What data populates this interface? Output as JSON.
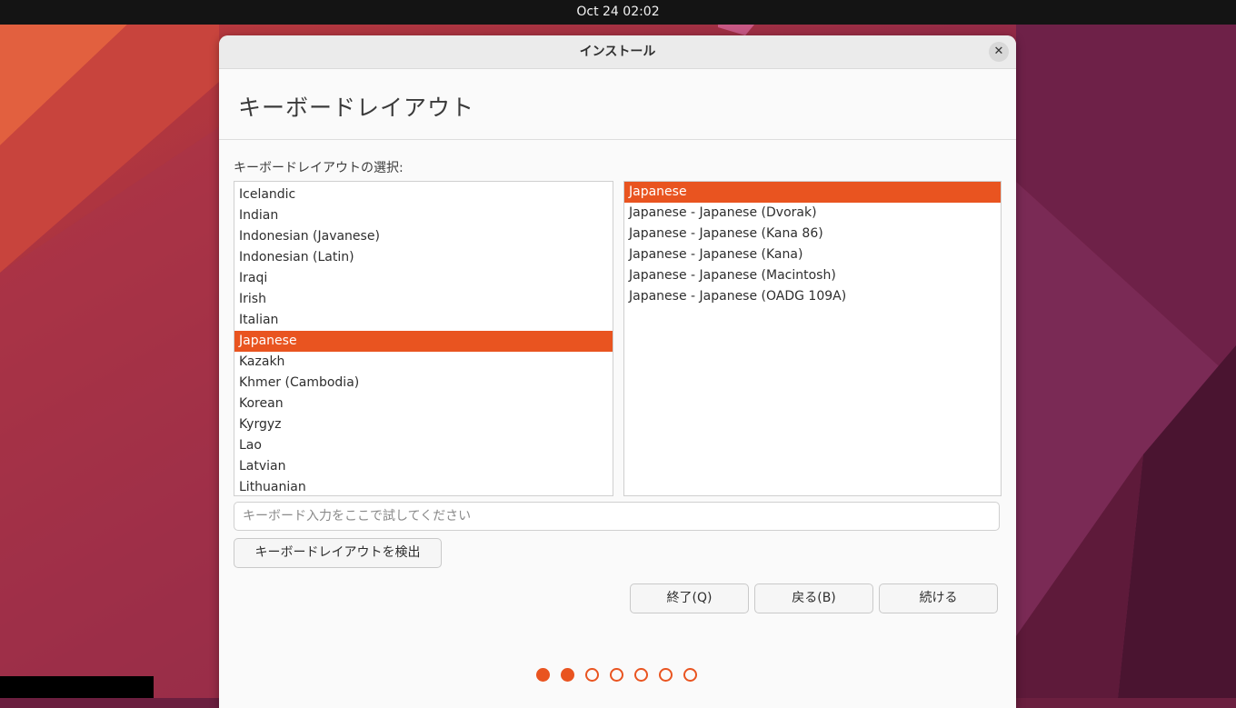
{
  "topbar": {
    "clock": "Oct 24  02:02"
  },
  "window": {
    "title": "インストール",
    "close_label": "✕"
  },
  "page": {
    "title": "キーボードレイアウト",
    "select_label": "キーボードレイアウトの選択:"
  },
  "layouts": {
    "items": [
      "Icelandic",
      "Indian",
      "Indonesian (Javanese)",
      "Indonesian (Latin)",
      "Iraqi",
      "Irish",
      "Italian",
      "Japanese",
      "Kazakh",
      "Khmer (Cambodia)",
      "Korean",
      "Kyrgyz",
      "Lao",
      "Latvian",
      "Lithuanian"
    ],
    "selected": "Japanese"
  },
  "variants": {
    "items": [
      "Japanese",
      "Japanese - Japanese (Dvorak)",
      "Japanese - Japanese (Kana 86)",
      "Japanese - Japanese (Kana)",
      "Japanese - Japanese (Macintosh)",
      "Japanese - Japanese (OADG 109A)"
    ],
    "selected": "Japanese"
  },
  "test_input": {
    "placeholder": "キーボード入力をここで試してください",
    "value": ""
  },
  "buttons": {
    "detect": "キーボードレイアウトを検出",
    "quit": "終了(Q)",
    "back": "戻る(B)",
    "next": "続ける"
  },
  "progress": {
    "total_steps": 7,
    "completed_steps": 2
  },
  "colors": {
    "accent": "#e95420",
    "topbar": "#141414"
  }
}
